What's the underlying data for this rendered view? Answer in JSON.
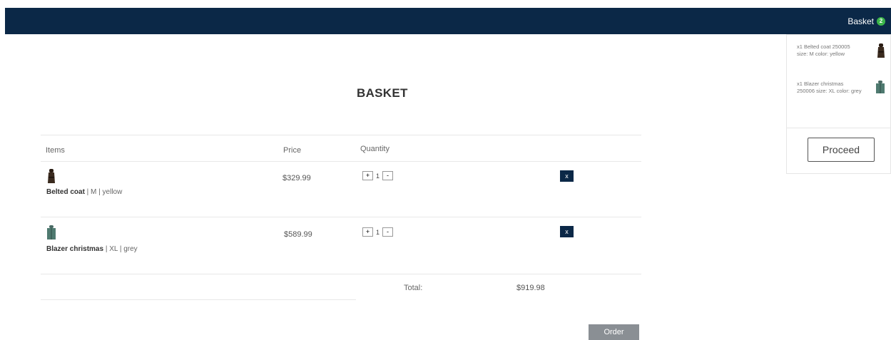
{
  "header": {
    "basket_label": "Basket",
    "basket_count": "2"
  },
  "minicart": {
    "items": [
      {
        "text": "x1 Belted coat 250005 size: M color: yellow",
        "icon": "coat-thumbnail"
      },
      {
        "text": "x1 Blazer christmas 250006 size: XL color: grey",
        "icon": "blazer-thumbnail"
      }
    ],
    "proceed_label": "Proceed"
  },
  "page": {
    "title": "BASKET"
  },
  "table": {
    "headers": {
      "items": "Items",
      "price": "Price",
      "quantity": "Quantity"
    },
    "rows": [
      {
        "name": "Belted coat",
        "details": " | M | yellow",
        "price": "$329.99",
        "qty": "1",
        "remove": "x"
      },
      {
        "name": "Blazer christmas",
        "details": " | XL | grey",
        "price": "$589.99",
        "qty": "1",
        "remove": "x"
      }
    ],
    "plus": "+",
    "minus": "-"
  },
  "summary": {
    "total_label": "Total:",
    "total_value": "$919.98"
  },
  "actions": {
    "order_label": "Order"
  },
  "colors": {
    "navbar": "#0b2847",
    "badge": "#3cb54a",
    "order_button": "#8a8f94"
  }
}
